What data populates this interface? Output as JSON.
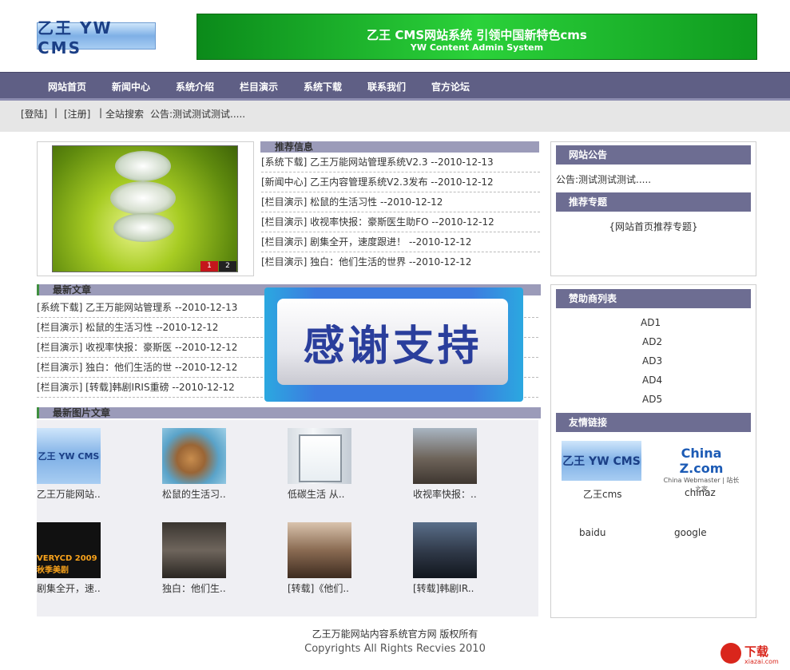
{
  "header": {
    "logo_text": "乙王 YW CMS",
    "banner_title": "乙王 CMS网站系统 引领中国新特色cms",
    "banner_subtitle": "YW Content Admin System"
  },
  "nav": [
    "网站首页",
    "新闻中心",
    "系统介绍",
    "栏目演示",
    "系统下载",
    "联系我们",
    "官方论坛"
  ],
  "subbar": {
    "login": "[登陆]",
    "sep1": "|",
    "register": "[注册]",
    "sep2": "|",
    "search": "全站搜索",
    "notice": "公告:测试测试测试....."
  },
  "slideshow": {
    "pages": [
      "1",
      "2"
    ]
  },
  "recommended": {
    "title": "推荐信息",
    "items": [
      "[系统下载] 乙王万能网站管理系统V2.3 --2010-12-13",
      "[新闻中心] 乙王内容管理系统V2.3发布 --2010-12-12",
      "[栏目演示] 松鼠的生活习性 --2010-12-12",
      "[栏目演示] 收视率快报：豪斯医生助FO --2010-12-12",
      "[栏目演示] 剧集全开，速度跟进！ --2010-12-12",
      "[栏目演示] 独白：他们生活的世界 --2010-12-12"
    ]
  },
  "latest": {
    "title": "最新文章",
    "items": [
      "[系统下载] 乙王万能网站管理系 --2010-12-13",
      "[栏目演示] 松鼠的生活习性 --2010-12-12",
      "[栏目演示] 收视率快报：豪斯医 --2010-12-12",
      "[栏目演示] 独白：他们生活的世 --2010-12-12",
      "[栏目演示] [转载]韩剧IRIS重磅 --2010-12-12"
    ]
  },
  "thanks_banner": "感谢支持",
  "pictures": {
    "title": "最新图片文章",
    "items": [
      {
        "caption": "乙王万能网站..",
        "thumb_text": "乙王 YW CMS"
      },
      {
        "caption": "松鼠的生活习..",
        "thumb_text": ""
      },
      {
        "caption": "低碳生活 从..",
        "thumb_text": ""
      },
      {
        "caption": "收视率快报：..",
        "thumb_text": ""
      },
      {
        "caption": "剧集全开，速..",
        "thumb_text": "VERYCD 2009秋季美剧"
      },
      {
        "caption": "独白：他们生..",
        "thumb_text": ""
      },
      {
        "caption": "[转载]《他们..",
        "thumb_text": ""
      },
      {
        "caption": "[转载]韩剧IR..",
        "thumb_text": ""
      }
    ]
  },
  "sidebar": {
    "notice_title": "网站公告",
    "notice_text": "公告:测试测试测试.....",
    "topic_title": "推荐专题",
    "topic_text": "{网站首页推荐专题}",
    "sponsor_title": "赞助商列表",
    "ads": [
      "AD1",
      "AD2",
      "AD3",
      "AD4",
      "AD5"
    ],
    "links_title": "友情链接",
    "link_logos": [
      "乙王 YW CMS",
      "China Z.com"
    ],
    "link_logo_sub": "China Webmaster | 站长之家",
    "links": [
      "乙王cms",
      "chinaz",
      "baidu",
      "google"
    ]
  },
  "footer": {
    "line1": "乙王万能网站内容系统官方网 版权所有",
    "line2": "Copyrights All Rights Recvies 2010"
  },
  "watermark": {
    "text": "下载",
    "sub": "xiazai.com"
  },
  "colors": {
    "nav": "#5f5f85",
    "section": "#9b9bb9",
    "side_title": "#6d6d92",
    "banner": "#1fbd2e"
  }
}
